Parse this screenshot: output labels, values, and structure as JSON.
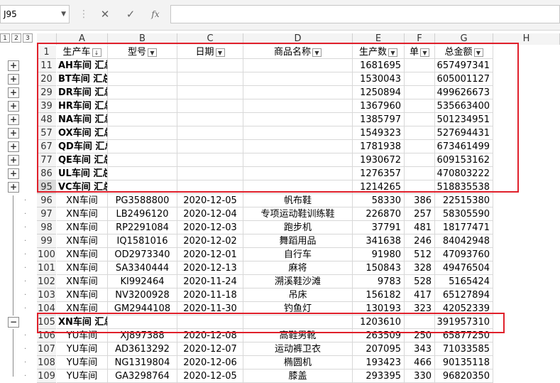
{
  "name_box": "J95",
  "formula_buttons": [
    "✕",
    "✓",
    "fx"
  ],
  "outline_levels": [
    "1",
    "2",
    "3"
  ],
  "columns": [
    "A",
    "B",
    "C",
    "D",
    "E",
    "F",
    "G",
    "H"
  ],
  "header_row": {
    "row": "1",
    "cells": [
      "生产车",
      "型号",
      "日期",
      "商品名称",
      "生产数",
      "单",
      "总金额"
    ]
  },
  "summary_rows": [
    {
      "row": "11",
      "label": "AH车间 汇总",
      "qty": "1681695",
      "total": "657497341"
    },
    {
      "row": "20",
      "label": "BT车间 汇总",
      "qty": "1530043",
      "total": "605001127"
    },
    {
      "row": "29",
      "label": "DR车间 汇总",
      "qty": "1250894",
      "total": "499626673"
    },
    {
      "row": "39",
      "label": "HR车间 汇总",
      "qty": "1367960",
      "total": "535663400"
    },
    {
      "row": "48",
      "label": "NA车间 汇总",
      "qty": "1385797",
      "total": "501234951"
    },
    {
      "row": "57",
      "label": "OX车间 汇总",
      "qty": "1549323",
      "total": "527694431"
    },
    {
      "row": "67",
      "label": "QD车间 汇总",
      "qty": "1781938",
      "total": "673461499"
    },
    {
      "row": "77",
      "label": "QE车间 汇总",
      "qty": "1930672",
      "total": "609153162"
    },
    {
      "row": "86",
      "label": "UL车间 汇总",
      "qty": "1276357",
      "total": "470803222"
    },
    {
      "row": "95",
      "label": "VC车间 汇总",
      "qty": "1214265",
      "total": "518835538"
    }
  ],
  "detail_rows": [
    {
      "row": "96",
      "ws": "XN车间",
      "model": "PG3588800",
      "date": "2020-12-05",
      "product": "帆布鞋",
      "qty": "58330",
      "price": "386",
      "total": "22515380"
    },
    {
      "row": "97",
      "ws": "XN车间",
      "model": "LB2496120",
      "date": "2020-12-04",
      "product": "专项运动鞋训练鞋",
      "qty": "226870",
      "price": "257",
      "total": "58305590"
    },
    {
      "row": "98",
      "ws": "XN车间",
      "model": "RP2291084",
      "date": "2020-12-03",
      "product": "跑步机",
      "qty": "37791",
      "price": "481",
      "total": "18177471"
    },
    {
      "row": "99",
      "ws": "XN车间",
      "model": "IQ1581016",
      "date": "2020-12-02",
      "product": "舞蹈用品",
      "qty": "341638",
      "price": "246",
      "total": "84042948"
    },
    {
      "row": "100",
      "ws": "XN车间",
      "model": "OD2973340",
      "date": "2020-12-01",
      "product": "自行车",
      "qty": "91980",
      "price": "512",
      "total": "47093760"
    },
    {
      "row": "101",
      "ws": "XN车间",
      "model": "SA3340444",
      "date": "2020-12-13",
      "product": "麻将",
      "qty": "150843",
      "price": "328",
      "total": "49476504"
    },
    {
      "row": "102",
      "ws": "XN车间",
      "model": "KI992464",
      "date": "2020-11-24",
      "product": "溯溪鞋沙滩",
      "qty": "9783",
      "price": "528",
      "total": "5165424"
    },
    {
      "row": "103",
      "ws": "XN车间",
      "model": "NV3200928",
      "date": "2020-11-18",
      "product": "吊床",
      "qty": "156182",
      "price": "417",
      "total": "65127894"
    },
    {
      "row": "104",
      "ws": "XN车间",
      "model": "GM2944108",
      "date": "2020-11-30",
      "product": "钓鱼灯",
      "qty": "130193",
      "price": "323",
      "total": "42052339"
    }
  ],
  "xn_summary": {
    "row": "105",
    "label": "XN车间 汇总",
    "qty": "1203610",
    "total": "391957310"
  },
  "detail_rows2": [
    {
      "row": "106",
      "ws": "YU车间",
      "model": "XJ897388",
      "date": "2020-12-08",
      "product": "高鞋男靴",
      "qty": "263509",
      "price": "250",
      "total": "65877250"
    },
    {
      "row": "107",
      "ws": "YU车间",
      "model": "AD3613292",
      "date": "2020-12-07",
      "product": "运动裤卫衣",
      "qty": "207095",
      "price": "343",
      "total": "71033585"
    },
    {
      "row": "108",
      "ws": "YU车间",
      "model": "NG1319804",
      "date": "2020-12-06",
      "product": "椭圆机",
      "qty": "193423",
      "price": "466",
      "total": "90135118"
    },
    {
      "row": "109",
      "ws": "YU车间",
      "model": "GA3298764",
      "date": "2020-12-05",
      "product": "膝盖",
      "qty": "293395",
      "price": "330",
      "total": "96820350"
    }
  ]
}
